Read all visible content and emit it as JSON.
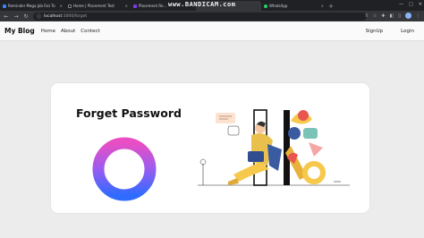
{
  "browser": {
    "tabs": [
      {
        "label": "Reminder Mega Job Fair To",
        "favicon_color": "#3b82f6",
        "active": false
      },
      {
        "label": "Home | Placement Test",
        "favicon_color": "#111111",
        "active": false
      },
      {
        "label": "Placement Re...",
        "favicon_color": "#7c3aed",
        "active": false
      },
      {
        "label": "",
        "favicon_color": "#35363a",
        "active": true
      },
      {
        "label": "WhatsApp",
        "favicon_color": "#25d366",
        "active": false
      }
    ],
    "watermark": "www.BANDICAM.com",
    "address_host": "localhost",
    "address_path": ":3000/forget",
    "window_controls": [
      "—",
      "□",
      "✕"
    ]
  },
  "navbar": {
    "brand": "My Blog",
    "links": [
      "Home",
      "About",
      "Contect"
    ],
    "right_links": [
      "SignUp",
      "Login"
    ]
  },
  "card": {
    "title": "Forget Password"
  },
  "colors": {
    "page_bg": "#ececec",
    "ring_start": "#e94ec3",
    "ring_end": "#2f6bff",
    "illustration_yellow": "#f6c84c",
    "illustration_blue": "#3a5ba0"
  }
}
